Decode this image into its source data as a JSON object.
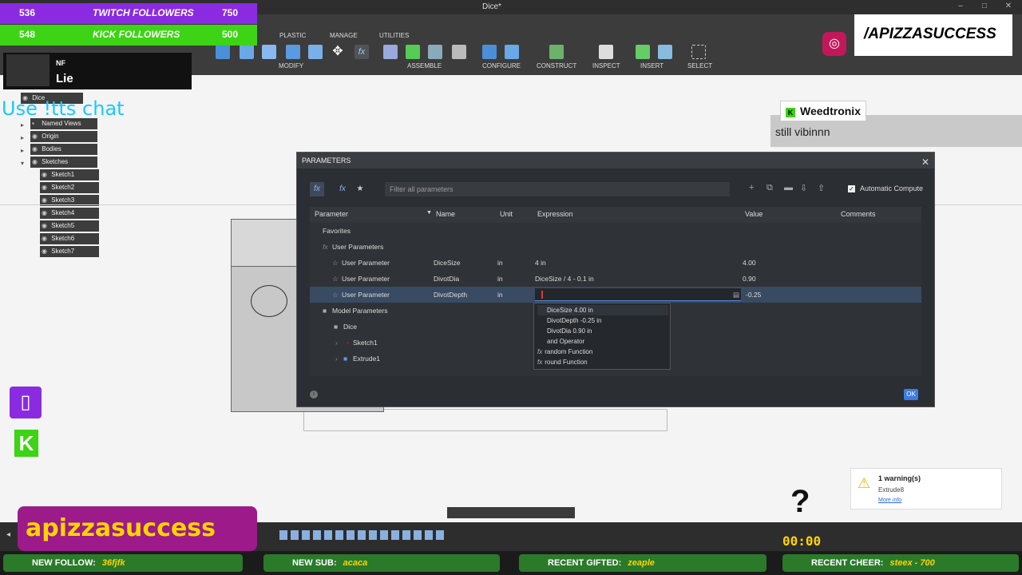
{
  "app": {
    "doc_title": "Dice*",
    "ribbon_tabs": [
      "PLASTIC",
      "MANAGE",
      "UTILITIES"
    ],
    "ribbon_groups": [
      "MODIFY",
      "ASSEMBLE",
      "CONFIGURE",
      "CONSTRUCT",
      "INSPECT",
      "INSERT",
      "SELECT"
    ]
  },
  "browser": {
    "items": [
      {
        "label": "Dice"
      },
      {
        "label": "Named Views"
      },
      {
        "label": "Origin"
      },
      {
        "label": "Bodies"
      },
      {
        "label": "Sketches"
      },
      {
        "label": "Sketch1"
      },
      {
        "label": "Sketch2"
      },
      {
        "label": "Sketch3"
      },
      {
        "label": "Sketch4"
      },
      {
        "label": "Sketch5"
      },
      {
        "label": "Sketch6"
      },
      {
        "label": "Sketch7"
      }
    ]
  },
  "dialog": {
    "title": "PARAMETERS",
    "filter_placeholder": "Filter all parameters",
    "auto_compute": "Automatic Compute",
    "columns": [
      "Parameter",
      "Name",
      "Unit",
      "Expression",
      "Value",
      "Comments"
    ],
    "favorites": "Favorites",
    "user_params_group": "User Parameters",
    "user_params": [
      {
        "param": "User Parameter",
        "name": "DiceSize",
        "unit": "in",
        "expr": "4 in",
        "value": "4.00"
      },
      {
        "param": "User Parameter",
        "name": "DivotDia",
        "unit": "in",
        "expr": "DiceSize / 4 - 0.1 in",
        "value": "0.90"
      },
      {
        "param": "User Parameter",
        "name": "DivotDepth",
        "unit": "in",
        "expr": "",
        "value": "-0.25"
      }
    ],
    "model_params_group": "Model Parameters",
    "model_tree": [
      "Dice",
      "Sketch1",
      "Extrude1"
    ],
    "autocomplete": [
      {
        "name": "DiceSize",
        "detail": "4.00 in"
      },
      {
        "name": "DivotDepth",
        "detail": "-0.25 in"
      },
      {
        "name": "DivotDia",
        "detail": "0.90 in"
      },
      {
        "name": "and",
        "detail": "Operator"
      },
      {
        "name": "random",
        "detail": "Function"
      },
      {
        "name": "round",
        "detail": "Function"
      }
    ],
    "ok": "OK"
  },
  "overlay": {
    "counters": [
      {
        "n1": "536",
        "label": "TWITCH FOLLOWERS",
        "n2": "750",
        "color": "#8a2be2"
      },
      {
        "n1": "548",
        "label": "KICK FOLLOWERS",
        "n2": "500",
        "color": "#3cd414"
      }
    ],
    "nf_label": "NF",
    "now_playing": "Lie",
    "tts": "Use !tts chat",
    "ig_handle": "/APIZZASUCCESS",
    "chat_user": "Weedtronix",
    "chat_message": "still vibinnn",
    "banner": "apizzasuccess",
    "timer": "00:00",
    "ticker": [
      {
        "label": "NEW FOLLOW:",
        "value": "36fjfk"
      },
      {
        "label": "NEW SUB:",
        "value": "acaca"
      },
      {
        "label": "RECENT GIFTED:",
        "value": "zeaple"
      },
      {
        "label": "RECENT CHEER:",
        "value": "steex - 700"
      }
    ],
    "warning": {
      "title": "1 warning(s)",
      "item": "Extrude8",
      "link": "More info"
    }
  },
  "colors": {
    "accent": "#3d7ce0",
    "purple": "#8a2be2",
    "kick": "#3cd414",
    "gold": "#ffd400"
  }
}
